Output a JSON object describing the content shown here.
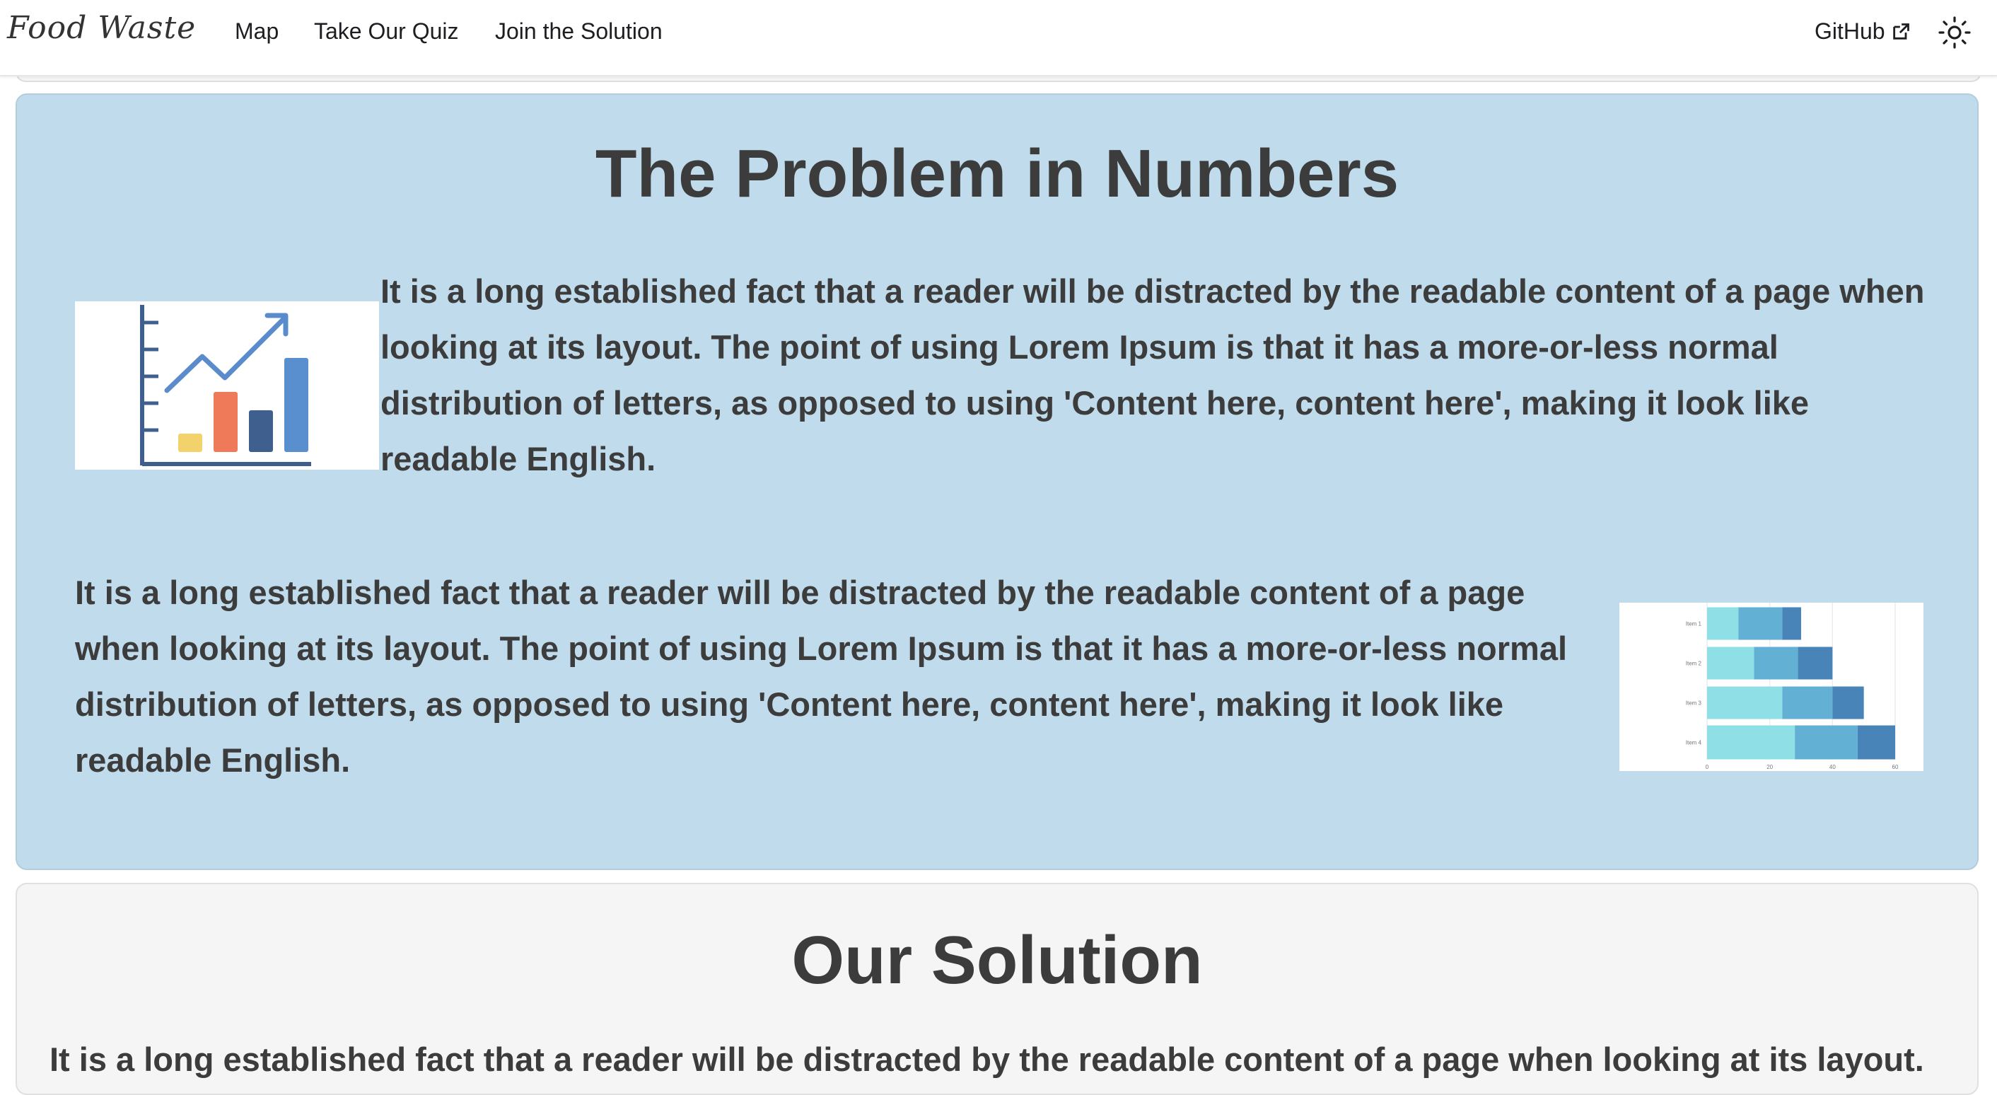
{
  "navbar": {
    "brand": "Food  Waste",
    "links": {
      "map": "Map",
      "quiz": "Take Our Quiz",
      "join": "Join the Solution"
    },
    "github": "GitHub"
  },
  "problem": {
    "title": "The Problem in Numbers",
    "paragraph_1": "It is a long established fact that a reader will be distracted by the readable content of a page when looking at its layout. The point of using Lorem Ipsum is that it has a more-or-less normal distribution of letters, as opposed to using 'Content here, content here', making it look like readable English.",
    "paragraph_2": "It is a long established fact that a reader will be distracted by the readable content of a page when looking at its layout. The point of using Lorem Ipsum is that it has a more-or-less normal distribution of letters, as opposed to using 'Content here, content here', making it look like readable English.",
    "stacked_chart": {
      "item_labels": [
        "Item 1",
        "Item 2",
        "Item 3",
        "Item 4"
      ],
      "axis_ticks": [
        "0",
        "20",
        "40",
        "60"
      ],
      "segments": [
        [
          10,
          14,
          6
        ],
        [
          15,
          14,
          11
        ],
        [
          24,
          16,
          10
        ],
        [
          28,
          20,
          12
        ]
      ],
      "colors": [
        "#8ee0e6",
        "#62b1d4",
        "#4884b8"
      ]
    },
    "icon_colors": {
      "axis": "#3f5f8f",
      "arrow": "#5a8ccc",
      "bar_yellow": "#f4d26b",
      "bar_orange": "#ef7a5a",
      "bar_navy": "#3f5f8f",
      "bar_blue": "#5a8fcf"
    }
  },
  "solution": {
    "title": "Our Solution",
    "paragraph": "It is a long established fact that a reader will be distracted by the readable content of a page when looking at its layout."
  }
}
